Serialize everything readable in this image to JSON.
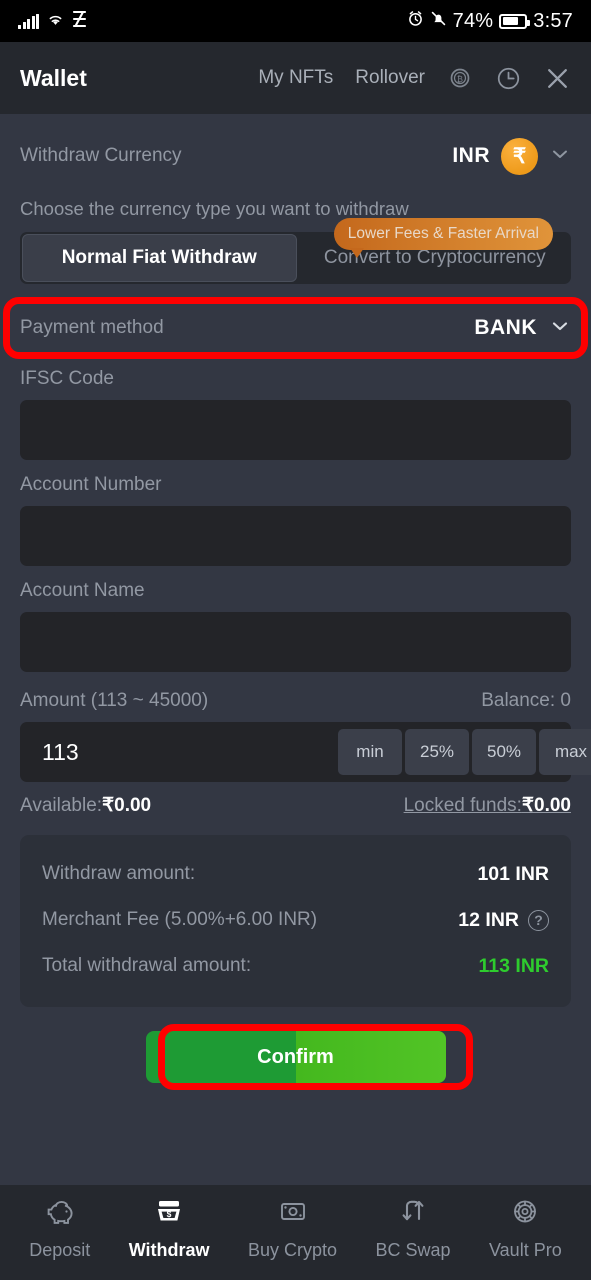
{
  "status_bar": {
    "battery_percent": "74%",
    "time": "3:57",
    "icons": [
      "signal-bars-icon",
      "wifi-icon",
      "network-icon",
      "alarm-icon",
      "bell-muted-icon",
      "battery-icon"
    ]
  },
  "header": {
    "title": "Wallet",
    "links": [
      {
        "label": "My NFTs",
        "name": "my-nfts-link"
      },
      {
        "label": "Rollover",
        "name": "rollover-link"
      }
    ],
    "icons": [
      {
        "name": "coin-icon"
      },
      {
        "name": "history-clock-icon"
      },
      {
        "name": "close-icon"
      }
    ]
  },
  "currency": {
    "label": "Withdraw Currency",
    "code": "INR",
    "symbol": "₹",
    "coin_color": "#EE9A1A",
    "chevron": "chevron-down-icon"
  },
  "type_selector": {
    "hint": "Choose the currency type you want to withdraw",
    "tooltip": "Lower Fees & Faster Arrival",
    "tooltip_color": "#D07E28",
    "options": [
      {
        "label": "Normal Fiat Withdraw",
        "active": true
      },
      {
        "label": "Convert to Cryptocurrency",
        "active": false
      }
    ]
  },
  "payment_method": {
    "label": "Payment method",
    "value": "BANK",
    "highlight_color": "#FF0000"
  },
  "fields": [
    {
      "label": "IFSC Code",
      "value": "",
      "placeholder": "",
      "name": "ifsc-code-field"
    },
    {
      "label": "Account Number",
      "value": "",
      "placeholder": "",
      "name": "account-number-field"
    },
    {
      "label": "Account Name",
      "value": "",
      "placeholder": "",
      "name": "account-name-field"
    }
  ],
  "amount": {
    "label": "Amount (113 ~ 45000)",
    "balance_label": "Balance: 0",
    "value": "113",
    "placeholder": "",
    "quick_buttons": [
      "min",
      "25%",
      "50%",
      "max"
    ],
    "available_label": "Available:",
    "available_value": "₹0.00",
    "locked_label": "Locked funds:",
    "locked_value": "₹0.00"
  },
  "summary": [
    {
      "key": "Withdraw amount:",
      "value": "101 INR",
      "green": false,
      "help": false
    },
    {
      "key": "Merchant Fee (5.00%+6.00 INR)",
      "value": "12 INR",
      "green": false,
      "help": true
    },
    {
      "key": "Total withdrawal amount:",
      "value": "113 INR",
      "green": true,
      "help": false
    }
  ],
  "confirm": {
    "label": "Confirm",
    "color_left": "#1E9B34",
    "color_right": "#52C426",
    "highlight_color": "#FF0000"
  },
  "bottom_nav": [
    {
      "label": "Deposit",
      "icon": "piggy-bank-icon",
      "active": false
    },
    {
      "label": "Withdraw",
      "icon": "cash-withdraw-icon",
      "active": true
    },
    {
      "label": "Buy Crypto",
      "icon": "banknote-icon",
      "active": false
    },
    {
      "label": "BC Swap",
      "icon": "swap-arrows-icon",
      "active": false
    },
    {
      "label": "Vault Pro",
      "icon": "vault-icon",
      "active": false
    }
  ]
}
